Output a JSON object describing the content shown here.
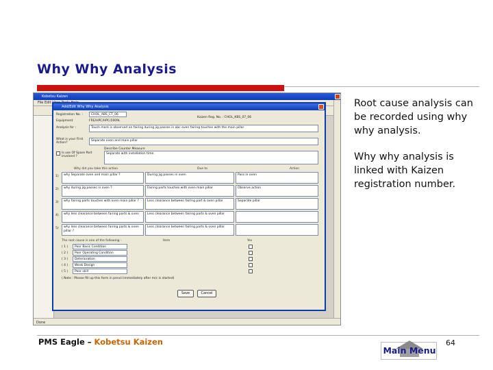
{
  "slide": {
    "title": "Why Why Analysis",
    "bullet_1": "Root cause analysis can be recorded using why why analysis.",
    "bullet_2": "Why why analysis is linked with Kaizen registration number.",
    "footer_part_a": "PMS Eagle",
    "footer_sep": " – ",
    "footer_part_b": "Kobetsu Kaizen",
    "main_menu_label": "Main Menu",
    "page_number": "64"
  },
  "screenshot": {
    "window_title": "Kobetsu Kaizen",
    "dialog_title": "Add/Edit Why Why Analysis",
    "status_text": "Done",
    "fields": {
      "reg_label": "Registration No. :",
      "reg_value": "CHOL_ABS_CT_06",
      "equip_label": "Equipment",
      "equip_value": "FRE/HPC/HPC/2009L",
      "kaizen_reg": "Kaizen Reg. No. : CHOL_KBS_07_06",
      "analysis_label": "Analysis for :",
      "analysis_value": "Touch mark is observed on fairing during jig passes in abc oven fairing touches with the main pillar",
      "first_action_label": "What is your First Action?",
      "first_action_value": "Separate oven and main pillar",
      "measure_label": "Describe Counter Measure",
      "measure_value": "Separate with installation time.",
      "spare_label": "Is use Of Spare Part involved ?"
    },
    "col_headers": [
      "Why did you take this action",
      "Due to",
      "Action"
    ],
    "rows": [
      {
        "num": "1)",
        "why": "why Separate oven and main pillar ?",
        "due": "During jig passes in oven",
        "action": "Pass in oven"
      },
      {
        "num": "2)",
        "why": "why during jig passes in oven ?",
        "due": "Fairing parts touches with oven main pillar",
        "action": "Observe action"
      },
      {
        "num": "3)",
        "why": "why fairing parts touches with oven main pillar ?",
        "due": "Less clearance between fairing part & oven pillar",
        "action": "Separate pillar"
      },
      {
        "num": "4)",
        "why": "why less clearance between fairing parts & oven",
        "due": "Less clearance between fairing parts & oven pillar",
        "action": ""
      },
      {
        "num": "5)",
        "why": "why less clearance between fairing parts & oven pillar ?",
        "due": "Less clearance between fairing parts & oven pillar",
        "action": ""
      }
    ],
    "checklist_header": "The root cause is one of the following :",
    "checklist_col": "Item",
    "checklist_col2": "Yes",
    "checklist": [
      {
        "num": "( 1 )",
        "label": "Poor Basic Condition"
      },
      {
        "num": "( 2 )",
        "label": "Poor Operating Condition"
      },
      {
        "num": "( 3 )",
        "label": "Deterioration"
      },
      {
        "num": "( 4 )",
        "label": "Weak Design"
      },
      {
        "num": "( 5 )",
        "label": "Poor skill"
      }
    ],
    "note": "( Note : Please fill up this form in pencil immediately after m/c is started)",
    "save_label": "Save",
    "cancel_label": "Cancel",
    "menu_text": "File  Edit  View  Tools  Help"
  }
}
